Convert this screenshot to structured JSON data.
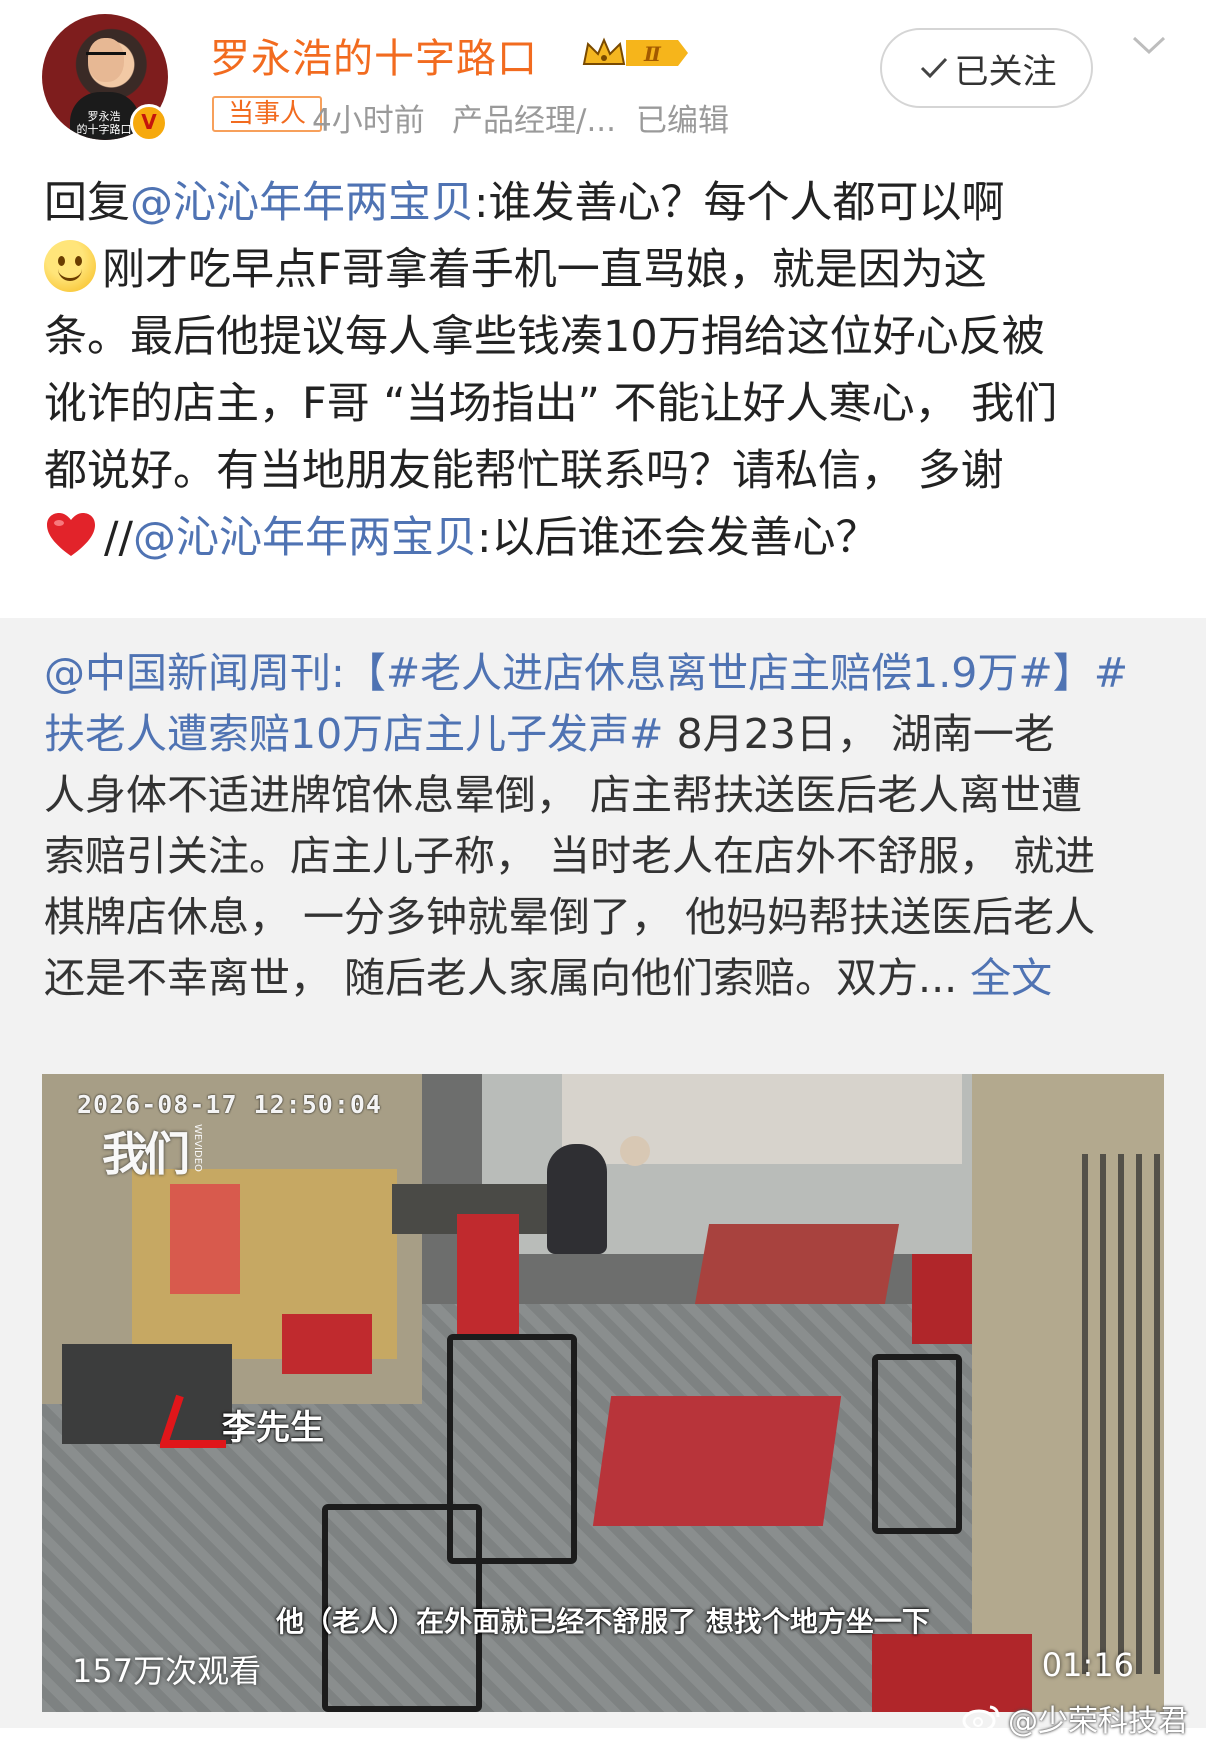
{
  "header": {
    "username": "罗永浩的十字路口",
    "vip_level": "Ⅱ",
    "avatar_caption_line1": "罗永浩",
    "avatar_caption_line2": "的十字路口",
    "verified_mark": "V",
    "tag": "当事人",
    "time": "4小时前",
    "source": "产品经理/...",
    "edited": "已编辑",
    "follow_label": "已关注"
  },
  "post": {
    "line1_prefix": "回复",
    "line1_mention": "@沁沁年年两宝贝",
    "line1_text": ":谁发善心？每个人都可以啊",
    "line2_text": "刚才吃早点F哥拿着手机一直骂娘，就是因为这",
    "line3_text": "条。最后他提议每人拿些钱凑10万捐给这位好心反被",
    "line4_text": "讹诈的店主，F哥 “当场指出” 不能让好人寒心， 我们",
    "line5_text": "都说好。有当地朋友能帮忙联系吗？请私信， 多谢",
    "line6_slashes": "//",
    "line6_mention": "@沁沁年年两宝贝",
    "line6_text": ":以后谁还会发善心？",
    "emoji1": "smile-emoji",
    "emoji2": "heart-emoji"
  },
  "repost": {
    "author_mention": "@中国新闻周刊",
    "colon": ":",
    "hashtag1": "【#老人进店休息离世店主赔偿1.9万#】#",
    "hashtag2": "扶老人遭索赔10万店主儿子发声#",
    "line2_text": " 8月23日， 湖南一老",
    "line3_text": "人身体不适进牌馆休息晕倒， 店主帮扶送医后老人离世遭",
    "line4_text": "索赔引关注。店主儿子称， 当时老人在店外不舒服， 就进",
    "line5_text": "棋牌店休息， 一分多钟就晕倒了， 他妈妈帮扶送医后老人",
    "line6_text": "还是不幸离世， 随后老人家属向他们索赔。双方... ",
    "full_text_link": "全文"
  },
  "video": {
    "timestamp": "2026-08-17  12:50:04",
    "logo": "我们",
    "logo_sub": "WEVIDEO",
    "name_label": "李先生",
    "subtitle": "他（老人）在外面就已经不舒服了 想找个地方坐一下",
    "views": "157万次观看",
    "duration": "01:16"
  },
  "watermark": "@少荣科技君",
  "colors": {
    "username": "#f26b1f",
    "link": "#4f73b3",
    "repost_bg": "#f2f2f2",
    "meta_gray": "#9a9a9a"
  }
}
